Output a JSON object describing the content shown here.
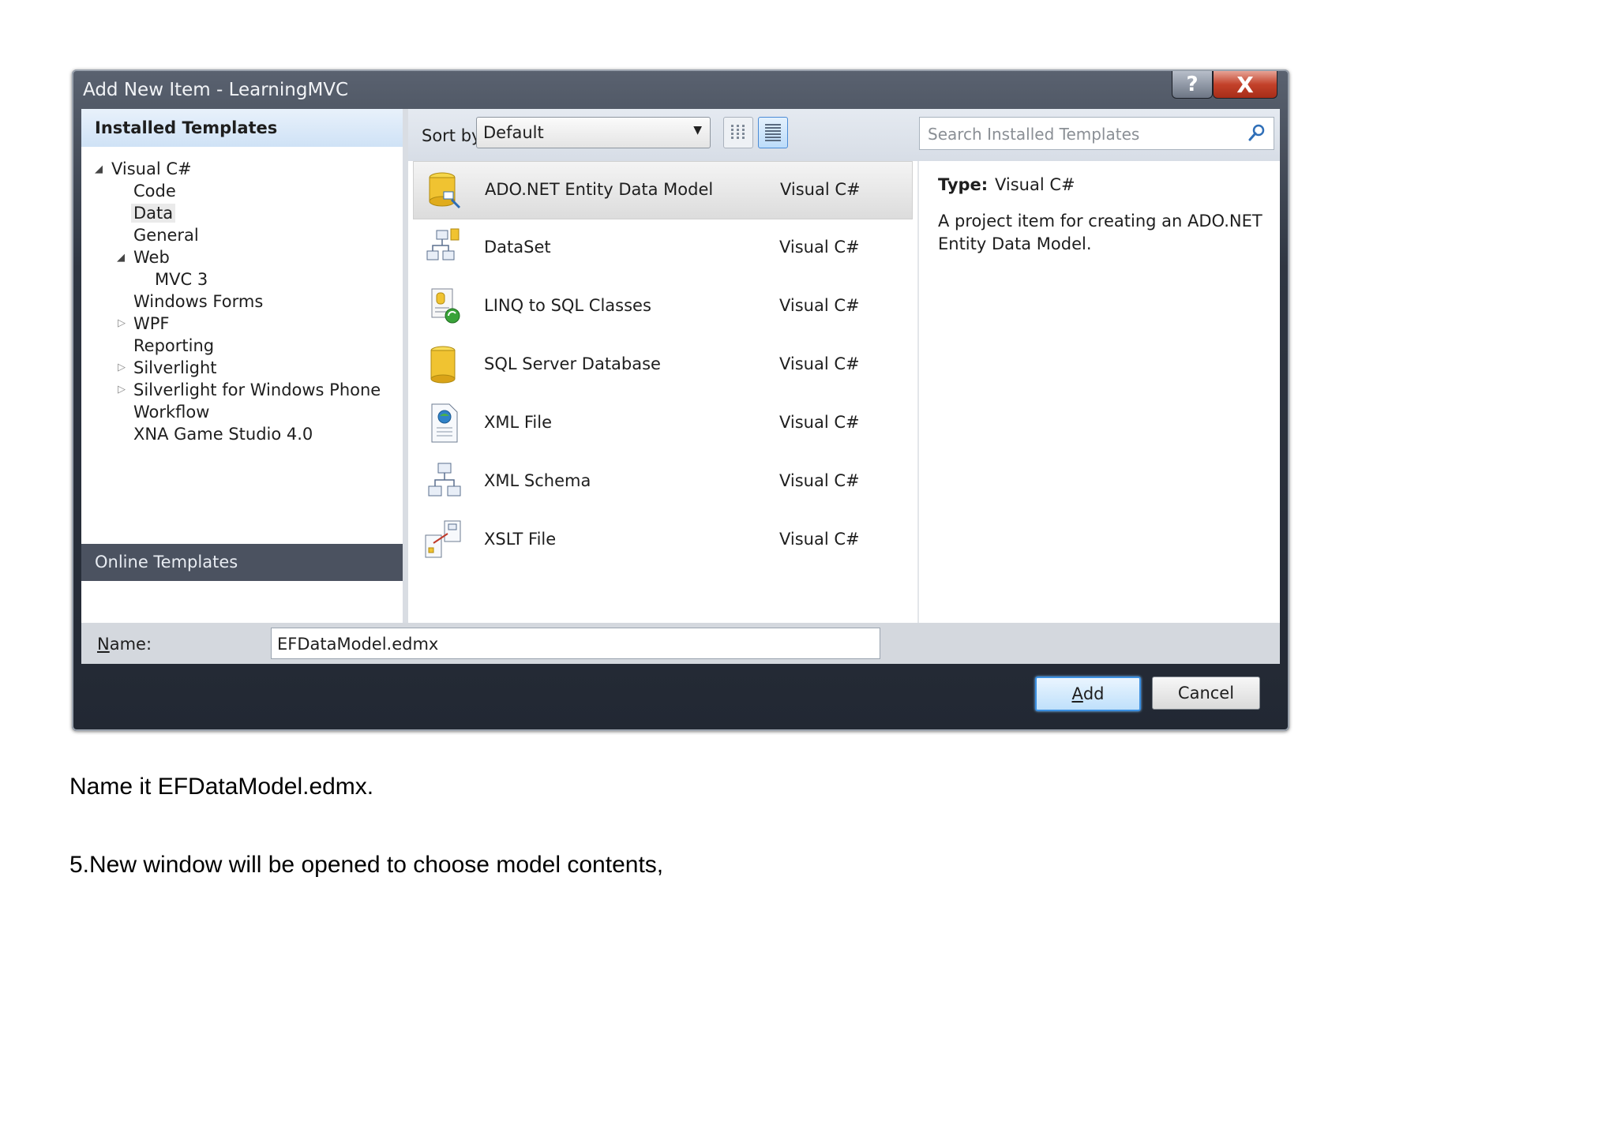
{
  "dialog": {
    "title": "Add New Item - LearningMVC",
    "help_label": "?",
    "close_label": "X"
  },
  "sidebar": {
    "installed_header": "Installed Templates",
    "tree": [
      {
        "label": "Visual C#",
        "expanded": true
      },
      {
        "label": "Code"
      },
      {
        "label": "Data",
        "selected": true
      },
      {
        "label": "General"
      },
      {
        "label": "Web",
        "expanded": true
      },
      {
        "label": "MVC 3"
      },
      {
        "label": "Windows Forms"
      },
      {
        "label": "WPF",
        "collapsed": true
      },
      {
        "label": "Reporting"
      },
      {
        "label": "Silverlight",
        "collapsed": true
      },
      {
        "label": "Silverlight for Windows Phone",
        "collapsed": true
      },
      {
        "label": "Workflow"
      },
      {
        "label": "XNA Game Studio 4.0"
      }
    ],
    "online_label": "Online Templates"
  },
  "toolbar": {
    "sort_label": "Sort by:",
    "sort_value": "Default",
    "search_placeholder": "Search Installed Templates"
  },
  "templates": [
    {
      "name": "ADO.NET Entity Data Model",
      "language": "Visual C#",
      "icon": "entity-model-icon",
      "selected": true
    },
    {
      "name": "DataSet",
      "language": "Visual C#",
      "icon": "dataset-icon"
    },
    {
      "name": "LINQ to SQL Classes",
      "language": "Visual C#",
      "icon": "linq-sql-icon"
    },
    {
      "name": "SQL Server Database",
      "language": "Visual C#",
      "icon": "database-icon"
    },
    {
      "name": "XML File",
      "language": "Visual C#",
      "icon": "xml-file-icon"
    },
    {
      "name": "XML Schema",
      "language": "Visual C#",
      "icon": "xml-schema-icon"
    },
    {
      "name": "XSLT File",
      "language": "Visual C#",
      "icon": "xslt-file-icon"
    }
  ],
  "details": {
    "type_label": "Type:",
    "type_value": "Visual C#",
    "description": "A project item for creating an ADO.NET Entity Data Model."
  },
  "name_field": {
    "label_accel": "N",
    "label_rest": "ame:",
    "value": "EFDataModel.edmx"
  },
  "buttons": {
    "add_accel": "A",
    "add_rest": "dd",
    "cancel": "Cancel"
  },
  "caption": {
    "line1": "Name it EFDataModel.edmx.",
    "line2": "5.New window will be opened to choose model contents,"
  }
}
